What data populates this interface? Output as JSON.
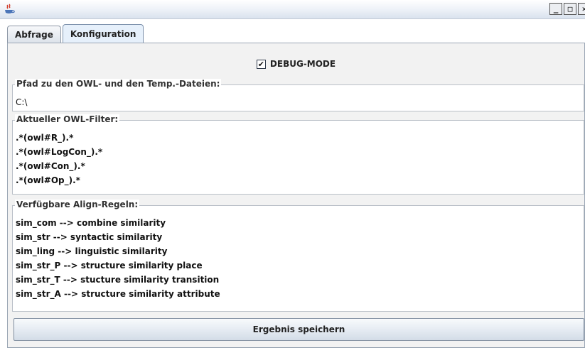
{
  "window": {
    "minimize_label": "_",
    "maximize_label": "□",
    "close_label": "✕"
  },
  "tabs": [
    {
      "label": "Abfrage",
      "active": false
    },
    {
      "label": "Konfiguration",
      "active": true
    }
  ],
  "debug": {
    "checked": true,
    "check_glyph": "✔",
    "label": "DEBUG-MODE"
  },
  "path_group": {
    "title": "Pfad zu den OWL- und den Temp.-Dateien:",
    "value": "C:\\"
  },
  "filter_group": {
    "title": "Aktueller OWL-Filter:",
    "lines": [
      ".*(owl#R_).*",
      ".*(owl#LogCon_).*",
      ".*(owl#Con_).*",
      ".*(owl#Op_).*"
    ]
  },
  "rules_group": {
    "title": "Verfügbare Align-Regeln:",
    "lines": [
      "sim_com --> combine similarity",
      "sim_str --> syntactic similarity",
      "sim_ling --> linguistic similarity",
      "sim_str_P --> structure similarity place",
      "sim_str_T --> stucture similarity transition",
      "sim_str_A --> structure similarity attribute"
    ]
  },
  "save_button": {
    "label": "Ergebnis speichern"
  }
}
